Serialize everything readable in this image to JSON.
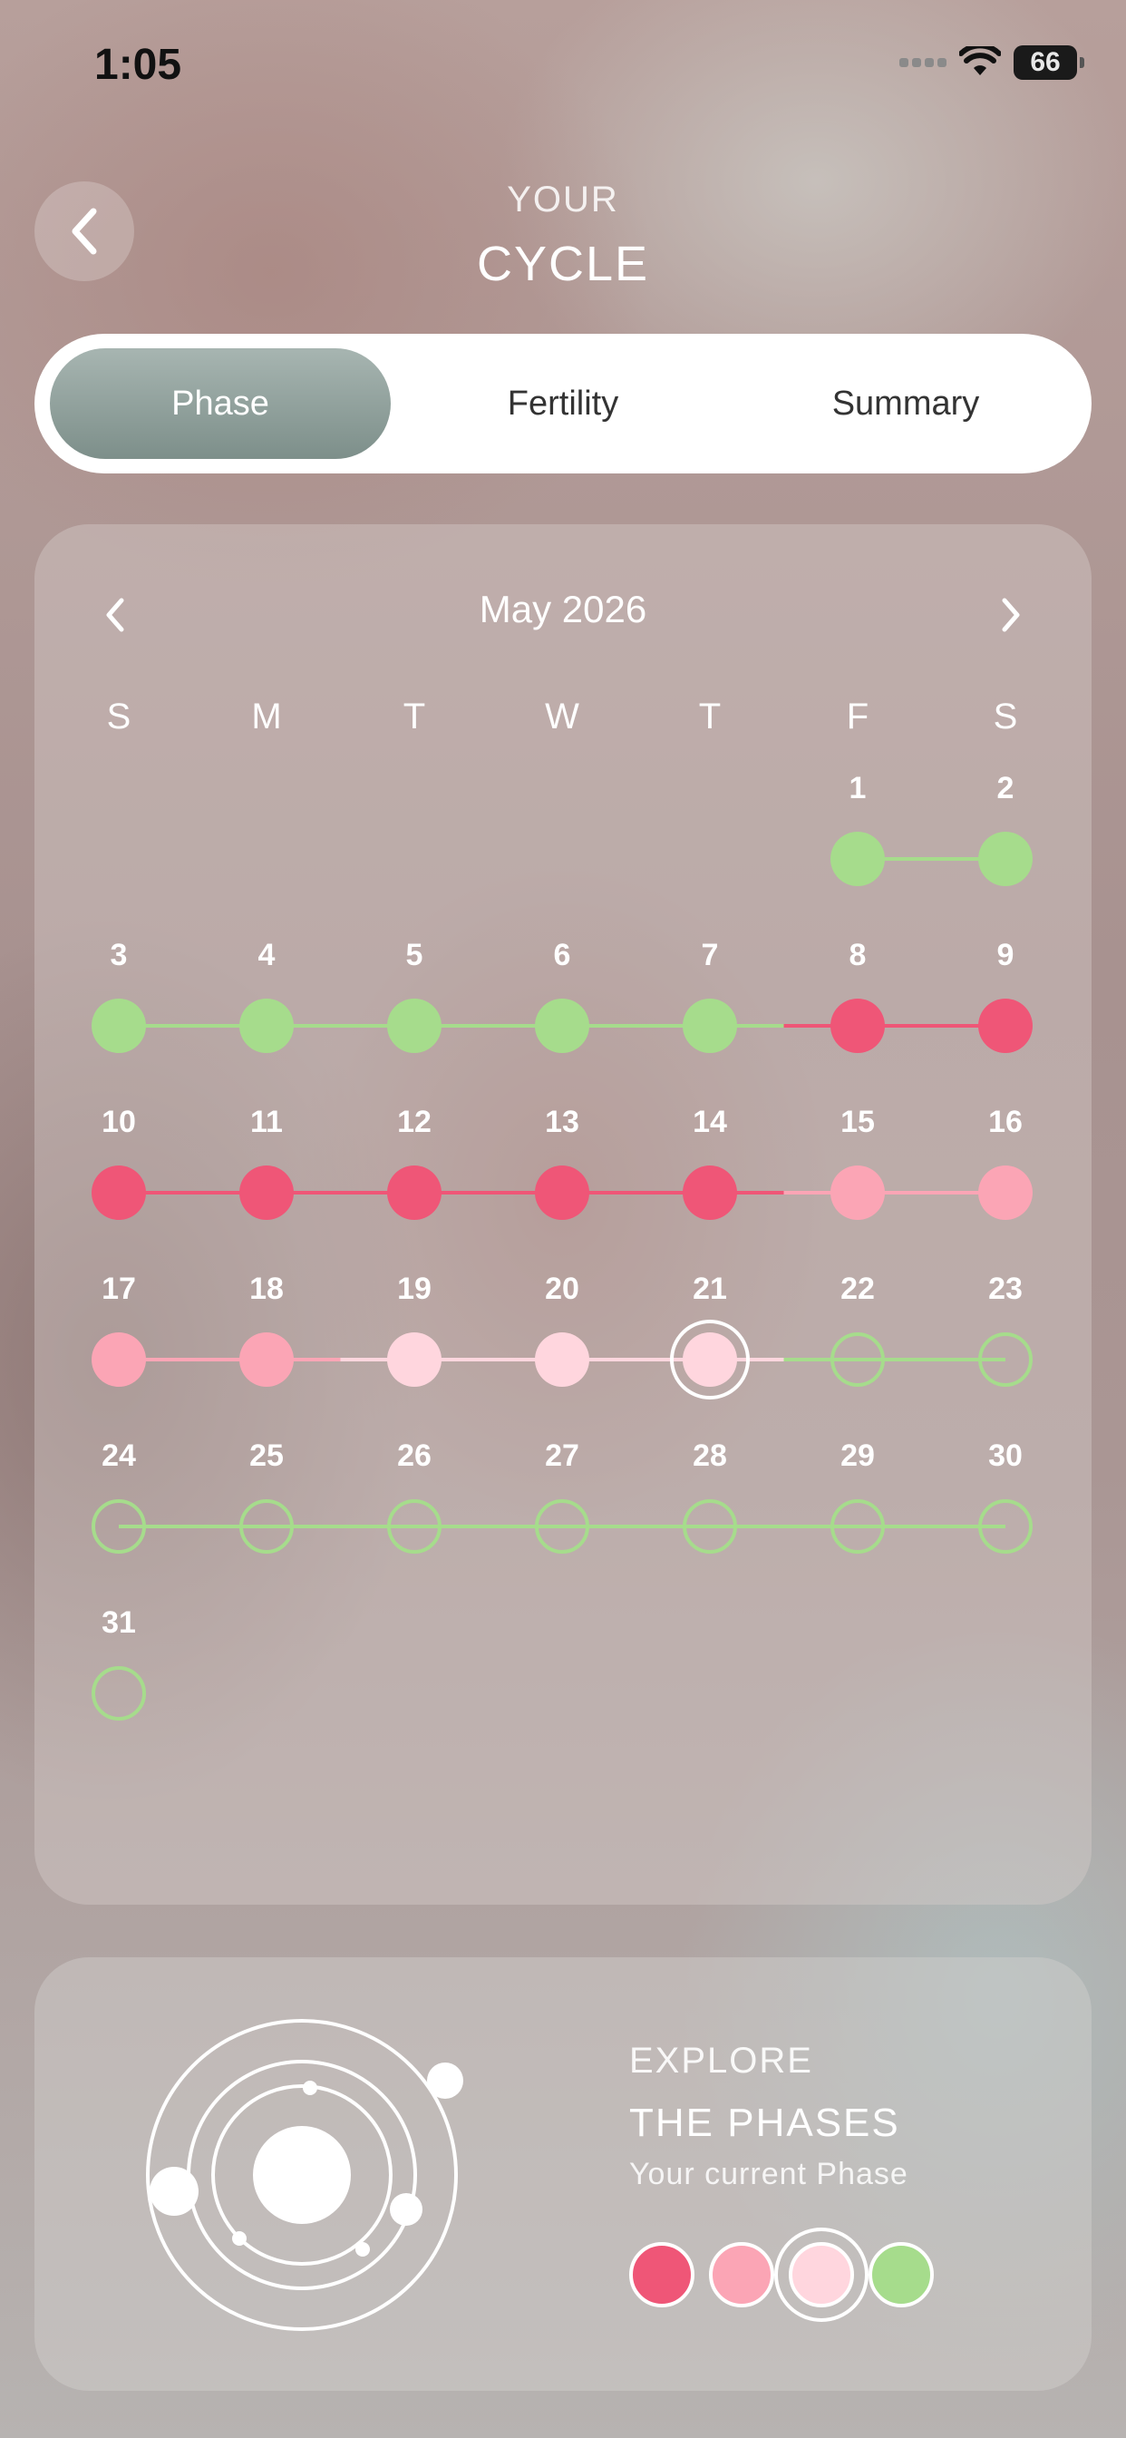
{
  "status_bar": {
    "time": "1:05",
    "battery": "66"
  },
  "header": {
    "subtitle": "YOUR",
    "title": "CYCLE",
    "back_icon": "chevron-left-icon"
  },
  "tabs": [
    {
      "label": "Phase",
      "active": true
    },
    {
      "label": "Fertility",
      "active": false
    },
    {
      "label": "Summary",
      "active": false
    }
  ],
  "calendar": {
    "month_label": "May 2026",
    "prev_icon": "chevron-left-icon",
    "next_icon": "chevron-right-icon",
    "weekdays": [
      "S",
      "M",
      "T",
      "W",
      "T",
      "F",
      "S"
    ],
    "first_weekday_index": 5,
    "days_in_month": 31,
    "today": 21,
    "phase_colors": {
      "follicular": "#a6dc8c",
      "menstrual": "#ef5677",
      "ovulation": "#fba5b5",
      "luteal": "#ffd6de",
      "predicted": "#a6dc8c"
    },
    "day_phases": [
      "follicular",
      "follicular",
      "follicular",
      "follicular",
      "follicular",
      "follicular",
      "follicular",
      "menstrual",
      "menstrual",
      "menstrual",
      "menstrual",
      "menstrual",
      "menstrual",
      "menstrual",
      "ovulation",
      "ovulation",
      "ovulation",
      "ovulation",
      "luteal",
      "luteal",
      "luteal",
      "predicted",
      "predicted",
      "predicted",
      "predicted",
      "predicted",
      "predicted",
      "predicted",
      "predicted",
      "predicted",
      "predicted"
    ]
  },
  "explore": {
    "subtitle": "EXPLORE",
    "title": "THE PHASES",
    "caption": "Your current Phase",
    "legend": [
      {
        "phase": "menstrual",
        "color": "#ef5677",
        "current": false
      },
      {
        "phase": "ovulation",
        "color": "#fba5b5",
        "current": false
      },
      {
        "phase": "luteal",
        "color": "#ffd6de",
        "current": true
      },
      {
        "phase": "follicular",
        "color": "#a6dc8c",
        "current": false
      }
    ],
    "orbit_icon": "cycle-orbit-icon"
  }
}
